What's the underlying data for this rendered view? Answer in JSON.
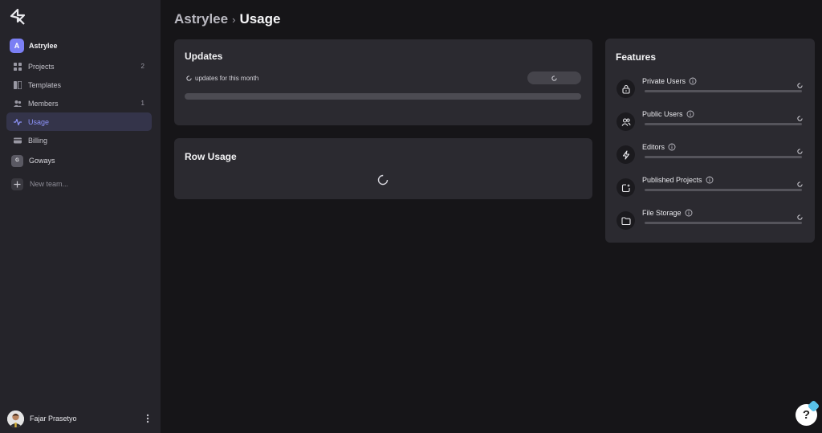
{
  "sidebar": {
    "team": {
      "initial": "A",
      "name": "Astrylee"
    },
    "items": [
      {
        "label": "Projects",
        "count": "2",
        "icon": "grid-icon"
      },
      {
        "label": "Templates",
        "count": "",
        "icon": "templates-icon"
      },
      {
        "label": "Members",
        "count": "1",
        "icon": "members-icon"
      },
      {
        "label": "Usage",
        "count": "",
        "icon": "activity-icon",
        "active": true
      },
      {
        "label": "Billing",
        "count": "",
        "icon": "billing-icon"
      }
    ],
    "workspace": {
      "initial": "G",
      "name": "Goways"
    },
    "new_team_label": "New team...",
    "user": {
      "name": "Fajar Prasetyo"
    }
  },
  "breadcrumb": {
    "parent": "Astrylee",
    "separator": "›",
    "current": "Usage"
  },
  "updates": {
    "title": "Updates",
    "subtitle": "updates for this month"
  },
  "row_usage": {
    "title": "Row Usage"
  },
  "features": {
    "title": "Features",
    "items": [
      {
        "label": "Private Users",
        "icon": "lock-icon"
      },
      {
        "label": "Public Users",
        "icon": "users-icon"
      },
      {
        "label": "Editors",
        "icon": "bolt-icon"
      },
      {
        "label": "Published Projects",
        "icon": "publish-icon"
      },
      {
        "label": "File Storage",
        "icon": "folder-icon"
      }
    ]
  },
  "help": {
    "label": "?"
  },
  "colors": {
    "accent": "#8d93f9",
    "background": "#161518",
    "sidebar": "#25242a",
    "card": "#2b2a30"
  }
}
